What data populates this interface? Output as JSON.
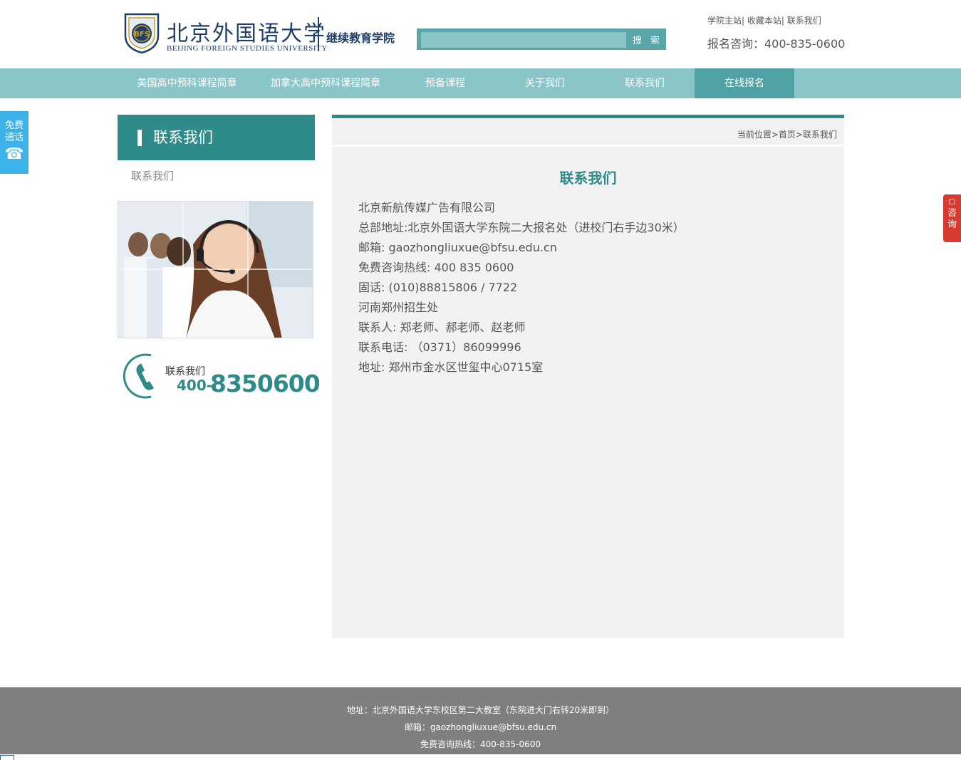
{
  "header": {
    "logo_cn": "北京外国语大学",
    "logo_en": "BEIJING FOREIGN STUDIES UNIVERSITY",
    "crest_text": "BFS",
    "school": "继续教育学院",
    "search_button": "搜 索",
    "search_placeholder": "",
    "links": [
      "学院主站",
      "收藏本站",
      "联系我们"
    ],
    "link_sep": "| ",
    "hotline": "报名咨询：400-835-0600"
  },
  "nav": {
    "items": [
      "美国高中预科课程简章",
      "加拿大高中预科课程简章",
      "预备课程",
      "关于我们",
      "联系我们",
      "在线报名"
    ],
    "active_index": 5
  },
  "float_left": {
    "line1": "免费",
    "line2": "通话",
    "icon": "☎"
  },
  "float_right": {
    "icon": "□",
    "text": "咨询"
  },
  "sidebar": {
    "title": "联系我们",
    "link": "联系我们",
    "contact_label": "联系我们",
    "contact_num_a": "400-",
    "contact_num_b": "8350600"
  },
  "main": {
    "breadcrumb": "当前位置>首页>联系我们",
    "title": "联系我们",
    "lines": [
      "北京新航传媒广告有限公司",
      "总部地址:北京外国语大学东院二大报名处（进校门右手边30米）",
      "邮箱: gaozhongliuxue@bfsu.edu.cn",
      "免费咨询热线: 400 835 0600",
      "固话: (010)88815806 / 7722",
      "河南郑州招生处",
      "联系人: 郑老师、郝老师、赵老师",
      "联系电话: （0371）86099996",
      "地址: 郑州市金水区世玺中心0715室"
    ]
  },
  "footer": {
    "address": "地址：北京外国语大学东校区第二大教室（东院进大门右转20米即到）",
    "email": "邮箱：gaozhongliuxue@bfsu.edu.cn",
    "hotline": "免费咨询热线：400-835-0600"
  },
  "colors": {
    "teal": "#2e8b8a",
    "nav_bg": "#8ac6c8",
    "nav_active": "#4fa1a4",
    "float_left": "#3bb2ea",
    "float_right": "#d83a32",
    "footer_bg": "#7f7f7f"
  }
}
